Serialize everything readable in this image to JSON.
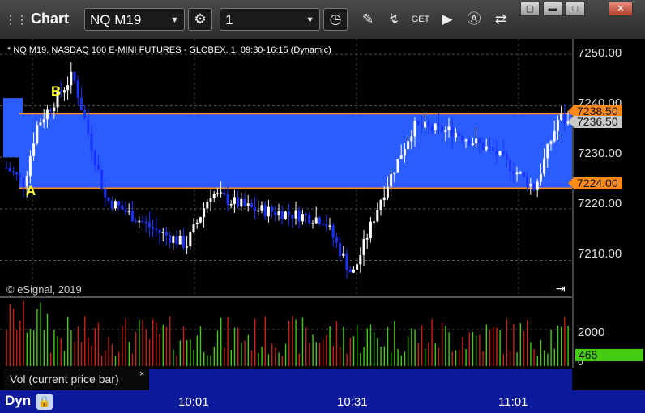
{
  "app": {
    "title": "Chart",
    "symbol": "NQ M19",
    "interval": "1"
  },
  "chart_header": "* NQ M19, NASDAQ 100 E-MINI FUTURES - GLOBEX, 1, 09:30-16:15 (Dynamic)",
  "copyright": "© eSignal, 2019",
  "annotations": {
    "a": "A",
    "b": "B"
  },
  "price_axis": {
    "labels": [
      "7250.00",
      "7240.00",
      "7230.00",
      "7220.00",
      "7210.00"
    ]
  },
  "price_tags": {
    "upper": "7238.50",
    "current": "7236.50",
    "lower": "7224.00"
  },
  "volume_panel": {
    "label": "Vol (current price bar)",
    "axis_label": "2000",
    "zero_label": "0",
    "current_value": "465",
    "close_symbol": "×"
  },
  "time_axis": {
    "labels": [
      "10:01",
      "10:31",
      "11:01"
    ]
  },
  "footer": {
    "mode": "Dyn"
  },
  "colors": {
    "up_candle": "#ffffff",
    "down_candle": "#1a33ff",
    "zone": "#2b5cff",
    "zone_line": "#ff8a1a",
    "vol_up": "#44cc11",
    "vol_down": "#cc2211"
  },
  "chart_data": {
    "type": "candlestick",
    "y_range": [
      7203,
      7253
    ],
    "horizontal_levels": [
      7238.5,
      7224.0
    ],
    "current_price": 7236.5,
    "current_volume": 465
  }
}
